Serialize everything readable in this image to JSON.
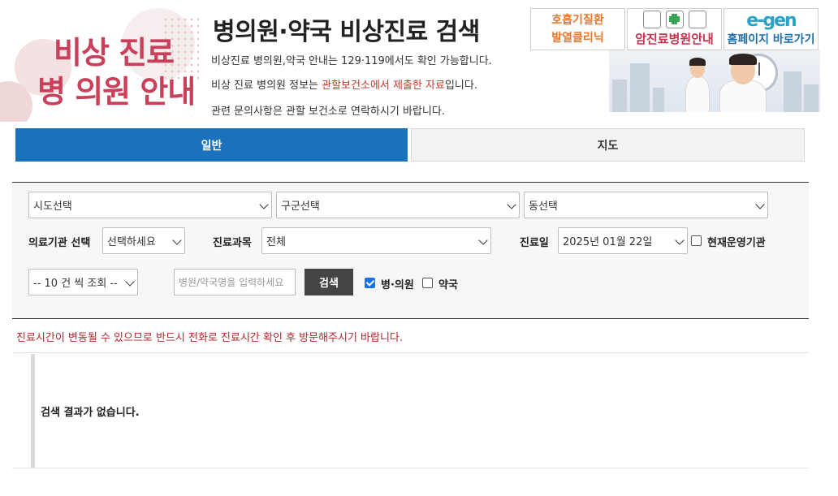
{
  "header": {
    "logo_line1": "비상 진료",
    "logo_line2": "병 의원 안내",
    "title": "병의원·약국 비상진료 검색",
    "desc1": "비상진료 병의원,약국 안내는 129·119에서도 확인 가능합니다.",
    "desc2_pre": "비상 진료 병의원 정보는 ",
    "desc2_red": "관할보건소에서 제출한 자료",
    "desc2_post": "입니다.",
    "desc3": "관련 문의사항은 관할 보건소로 연락하시기 바랍니다."
  },
  "banners": {
    "fever_line1": "호흡기질환",
    "fever_line2": "발열클리닉",
    "cancer_label": "암진료병원안내",
    "home_logo": "e-gen",
    "home_label": "홈페이지 바로가기"
  },
  "tabs": [
    {
      "label": "일반",
      "active": true
    },
    {
      "label": "지도",
      "active": false
    }
  ],
  "search": {
    "sido": "시도선택",
    "gugun": "구군선택",
    "dong": "동선택",
    "institution_label": "의료기관 선택",
    "institution_value": "선택하세요",
    "dept_label": "진료과목",
    "dept_value": "전체",
    "date_label": "진료일",
    "date_value": "2025년 01월 22일",
    "open_now_label": "현재운영기관",
    "page_size": "-- 10 건 씩 조회 --",
    "keyword_placeholder": "병원/약국명을 입력하세요",
    "search_button": "검색",
    "hospital_label": "병·의원",
    "pharmacy_label": "약국"
  },
  "notice": "진료시간이 변동될 수 있으므로 반드시 전화로 진료시간 확인 후 방문해주시기 바랍니다.",
  "result": {
    "empty_text": "검색 결과가 없습니다."
  },
  "colors": {
    "accent": "#1a72bd",
    "brand_red": "#c9405a",
    "notice_red": "#b5262b"
  }
}
